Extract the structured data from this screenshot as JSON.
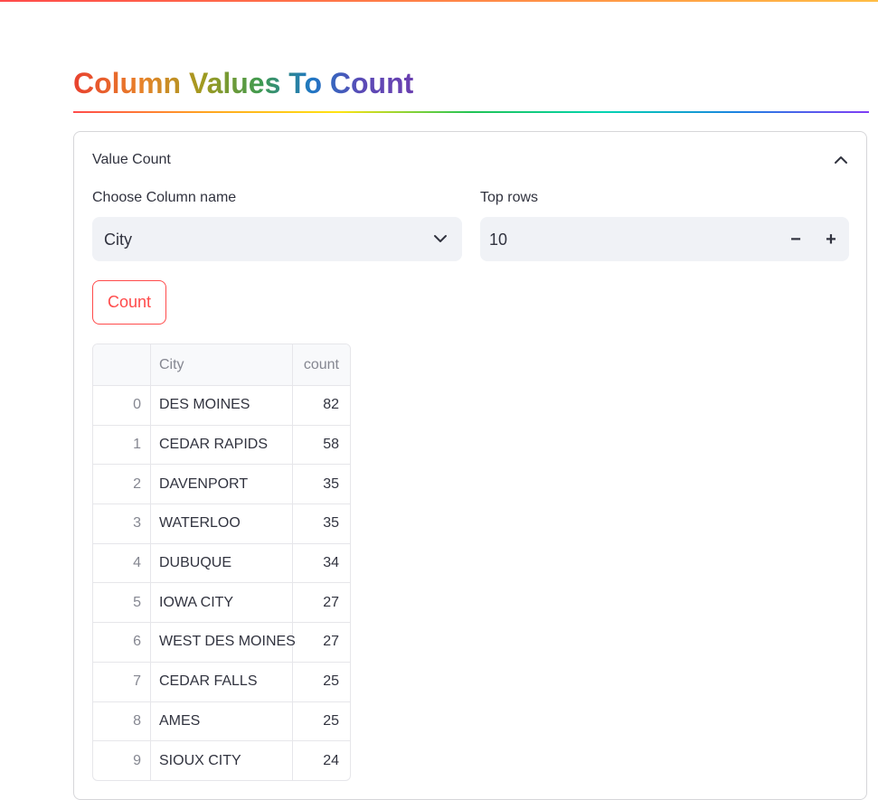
{
  "page": {
    "title": "Column Values To Count"
  },
  "expander": {
    "label": "Value Count",
    "icon": "chevron-up-icon"
  },
  "column_select": {
    "label": "Choose Column name",
    "value": "City",
    "icon": "chevron-down-icon"
  },
  "top_rows": {
    "label": "Top rows",
    "value": "10",
    "decrement": "−",
    "increment": "+"
  },
  "count_button": {
    "label": "Count"
  },
  "table": {
    "columns": [
      "",
      "City",
      "count"
    ],
    "rows": [
      {
        "index": "0",
        "city": "DES MOINES",
        "count": "82"
      },
      {
        "index": "1",
        "city": "CEDAR RAPIDS",
        "count": "58"
      },
      {
        "index": "2",
        "city": "DAVENPORT",
        "count": "35"
      },
      {
        "index": "3",
        "city": "WATERLOO",
        "count": "35"
      },
      {
        "index": "4",
        "city": "DUBUQUE",
        "count": "34"
      },
      {
        "index": "5",
        "city": "IOWA CITY",
        "count": "27"
      },
      {
        "index": "6",
        "city": "WEST DES MOINES",
        "count": "27"
      },
      {
        "index": "7",
        "city": "CEDAR FALLS",
        "count": "25"
      },
      {
        "index": "8",
        "city": "AMES",
        "count": "25"
      },
      {
        "index": "9",
        "city": "SIOUX CITY",
        "count": "24"
      }
    ]
  },
  "colors": {
    "accent": "#ff4b4b",
    "input_bg": "#f0f2f6",
    "text": "#31333f"
  }
}
